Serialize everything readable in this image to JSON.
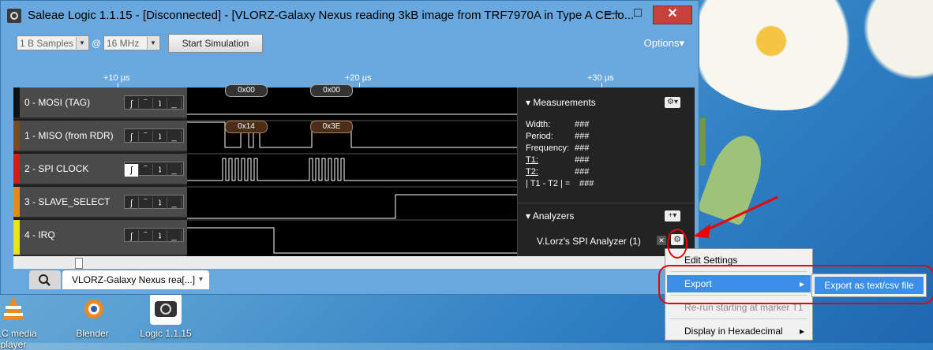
{
  "window": {
    "title": "Saleae Logic 1.1.15 - [Disconnected] - [VLORZ-Galaxy Nexus reading 3kB image from TRF7970A in Type A CE.lo...",
    "minimize": "—",
    "maximize": "□",
    "close": "✕"
  },
  "toolbar": {
    "samples": "1 B Samples",
    "at": "@",
    "rate": "16 MHz",
    "start_sim": "Start Simulation",
    "options": "Options▾"
  },
  "ruler": {
    "ticks": [
      "+10 µs",
      "+20 µs",
      "+30 µs"
    ]
  },
  "channels": [
    {
      "label": "0 - MOSI (TAG)",
      "color": "#111111"
    },
    {
      "label": "1 - MISO (from RDR)",
      "color": "#7a4a1e"
    },
    {
      "label": "2 - SPI CLOCK",
      "color": "#d51a1a"
    },
    {
      "label": "3 - SLAVE_SELECT",
      "color": "#e38b14"
    },
    {
      "label": "4 - IRQ",
      "color": "#e6e614"
    }
  ],
  "channel_buttons": [
    "ʃ",
    "‾",
    "ʇ",
    "_"
  ],
  "bubbles": {
    "mosi_a": "0x00",
    "mosi_b": "0x00",
    "miso_a": "0x14",
    "miso_b": "0x3E"
  },
  "measurements": {
    "title": "Measurements",
    "rows": [
      {
        "k": "Width:",
        "v": "###"
      },
      {
        "k": "Period:",
        "v": "###"
      },
      {
        "k": "Frequency:",
        "v": "###"
      },
      {
        "k": "T1:",
        "v": "###"
      },
      {
        "k": "T2:",
        "v": "###"
      },
      {
        "k": "| T1 - T2 | =",
        "v": "###"
      }
    ]
  },
  "analyzers": {
    "title": "Analyzers",
    "item": "V.Lorz's SPI Analyzer (1)",
    "remove": "✕"
  },
  "tabs": {
    "document": "VLORZ-Galaxy Nexus rea[...]"
  },
  "context_menu": {
    "items": [
      "Edit Settings",
      "Export",
      "Re-run starting at marker T1",
      "Display in Hexadecimal"
    ],
    "submenu": "Export as text/csv file",
    "arrow": "▸"
  },
  "desktop": {
    "icons": [
      "VLC media player",
      "Blender",
      "Logic 1.1.15"
    ]
  },
  "colors": {
    "titlebar": "#68a8de",
    "accent": "#3d8ee6",
    "annotation": "#e00000"
  }
}
